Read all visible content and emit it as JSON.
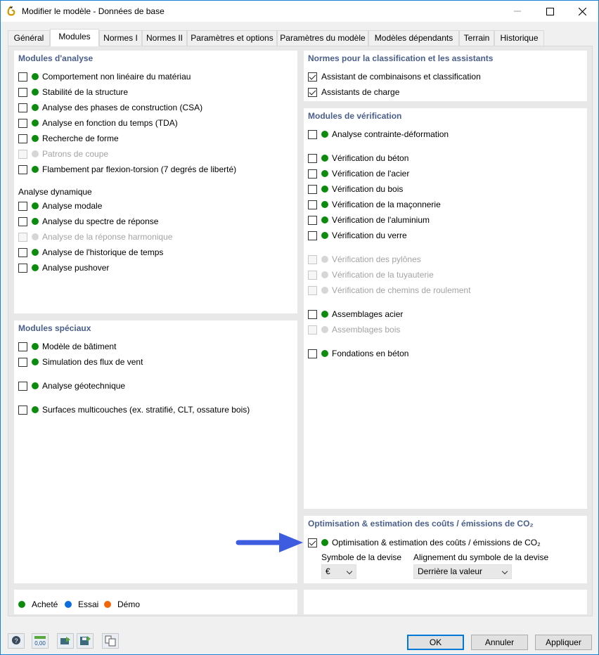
{
  "window": {
    "title": "Modifier le modèle - Données de base"
  },
  "tabs": [
    "Général",
    "Modules",
    "Normes I",
    "Normes II",
    "Paramètres et options",
    "Paramètres du modèle",
    "Modèles dépendants",
    "Terrain",
    "Historique"
  ],
  "analysis": {
    "title": "Modules d'analyse",
    "items": [
      {
        "label": "Comportement non linéaire du matériau",
        "enabled": true
      },
      {
        "label": "Stabilité de la structure",
        "enabled": true
      },
      {
        "label": "Analyse des phases de construction (CSA)",
        "enabled": true
      },
      {
        "label": "Analyse en fonction du temps (TDA)",
        "enabled": true
      },
      {
        "label": "Recherche de forme",
        "enabled": true
      },
      {
        "label": "Patrons de coupe",
        "enabled": false
      },
      {
        "label": "Flambement par flexion-torsion (7 degrés de liberté)",
        "enabled": true
      }
    ],
    "dynamic_title": "Analyse dynamique",
    "dynamic_items": [
      {
        "label": "Analyse modale",
        "enabled": true
      },
      {
        "label": "Analyse du spectre de réponse",
        "enabled": true
      },
      {
        "label": "Analyse de la réponse harmonique",
        "enabled": false
      },
      {
        "label": "Analyse de l'historique de temps",
        "enabled": true
      },
      {
        "label": "Analyse pushover",
        "enabled": true
      }
    ]
  },
  "special": {
    "title": "Modules spéciaux",
    "items": [
      {
        "label": "Modèle de bâtiment"
      },
      {
        "label": "Simulation des flux de vent"
      },
      {
        "label": "Analyse géotechnique"
      },
      {
        "label": "Surfaces multicouches (ex. stratifié, CLT, ossature bois)"
      }
    ]
  },
  "norms": {
    "title": "Normes pour la classification et les assistants",
    "items": [
      {
        "label": "Assistant de combinaisons et classification",
        "checked": true
      },
      {
        "label": "Assistants de charge",
        "checked": true
      }
    ]
  },
  "design": {
    "title": "Modules de vérification",
    "items": [
      {
        "label": "Analyse contrainte-déformation",
        "enabled": true
      },
      {
        "label": "Vérification du béton",
        "enabled": true
      },
      {
        "label": "Vérification de l'acier",
        "enabled": true
      },
      {
        "label": "Vérification du bois",
        "enabled": true
      },
      {
        "label": "Vérification de la maçonnerie",
        "enabled": true
      },
      {
        "label": "Vérification de l'aluminium",
        "enabled": true
      },
      {
        "label": "Vérification du verre",
        "enabled": true
      },
      {
        "label": "Vérification des pylônes",
        "enabled": false
      },
      {
        "label": "Vérification de la tuyauterie",
        "enabled": false
      },
      {
        "label": "Vérification de chemins de roulement",
        "enabled": false
      },
      {
        "label": "Assemblages acier",
        "enabled": true
      },
      {
        "label": "Assemblages bois",
        "enabled": false
      },
      {
        "label": "Fondations en béton",
        "enabled": true
      }
    ]
  },
  "optimization": {
    "title": "Optimisation & estimation des coûts / émissions de CO₂",
    "item": "Optimisation & estimation des coûts / émissions de CO₂",
    "currency_label": "Symbole de la devise",
    "currency_value": "€",
    "alignment_label": "Alignement du symbole de la devise",
    "alignment_value": "Derrière la valeur"
  },
  "legend": {
    "purchased": "Acheté",
    "trial": "Essai",
    "demo": "Démo"
  },
  "buttons": {
    "ok": "OK",
    "cancel": "Annuler",
    "apply": "Appliquer"
  },
  "colors": {
    "accent": "#0078d7",
    "purchased": "#0c8b0c",
    "trial": "#0a6ede",
    "demo": "#f2660a",
    "arrow": "#3d5ce0"
  }
}
